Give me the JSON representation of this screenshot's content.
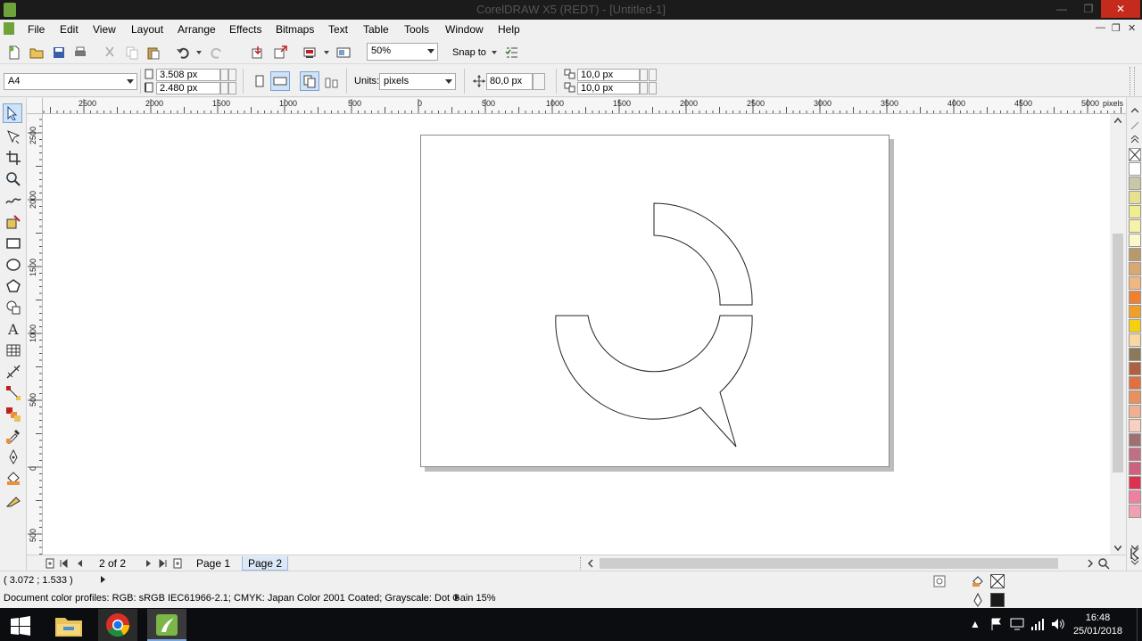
{
  "window": {
    "title": "CorelDRAW X5 (REDT) - [Untitled-1]",
    "minimize_glyph": "—",
    "restore_glyph": "❐",
    "close_glyph": "✕"
  },
  "menu": {
    "items": [
      "File",
      "Edit",
      "View",
      "Layout",
      "Arrange",
      "Effects",
      "Bitmaps",
      "Text",
      "Table",
      "Tools",
      "Window",
      "Help"
    ],
    "mdi_controls": [
      "—",
      "❐",
      "✕"
    ]
  },
  "standard_toolbar": {
    "zoom_value": "50%",
    "snap_to_label": "Snap to"
  },
  "property_bar": {
    "paper_size": "A4",
    "page_width": "3.508 px",
    "page_height": "2.480 px",
    "units_label": "Units:",
    "units_value": "pixels",
    "nudge_distance": "80,0 px",
    "duplicate_x": "10,0 px",
    "duplicate_y": "10,0 px"
  },
  "rulers": {
    "unit": "pixels",
    "h_labels": [
      "2500",
      "2000",
      "1500",
      "1000",
      "500",
      "0",
      "500",
      "1000",
      "1500",
      "2000",
      "2500",
      "3000",
      "3500",
      "4000",
      "4500",
      "5000"
    ],
    "v_labels": [
      "2500",
      "2000",
      "1500",
      "1000",
      "500",
      "0",
      "500"
    ]
  },
  "page_nav": {
    "page_count": "2 of 2",
    "tabs": [
      "Page 1",
      "Page 2"
    ],
    "active_tab": "Page 2"
  },
  "status": {
    "coordinates": "( 3.072 ; 1.533 )",
    "color_profiles": "Document color profiles: RGB: sRGB IEC61966-2.1; CMYK: Japan Color 2001 Coated; Grayscale: Dot Gain 15%"
  },
  "palette": {
    "colors": [
      "#c8c8a8",
      "#e6e090",
      "#f0ec90",
      "#f6f2a8",
      "#fbf8cc",
      "#b89a6a",
      "#d8a870",
      "#f0b880",
      "#f08030",
      "#f0a028",
      "#f4d010",
      "#f8d8a0",
      "#8a7a5a",
      "#b06040",
      "#e07040",
      "#e89060",
      "#f0b090",
      "#f8d0c0",
      "#a07070",
      "#c07080",
      "#d06080",
      "#e03050",
      "#f080a0",
      "#f0a0b0"
    ]
  },
  "taskbar": {
    "time": "16:48",
    "date": "25/01/2018"
  }
}
